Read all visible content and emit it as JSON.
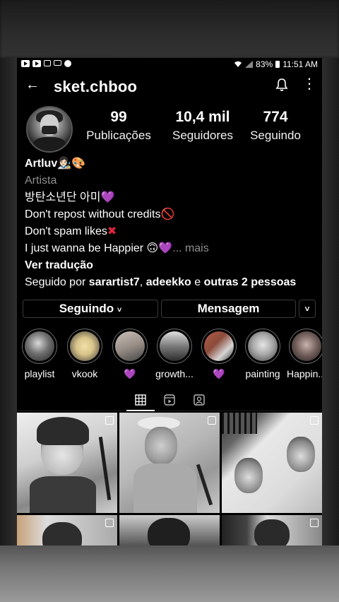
{
  "status_bar": {
    "battery": "83%",
    "time": "11:51 AM"
  },
  "header": {
    "username": "sket.chboo",
    "icons": [
      "back-arrow-icon",
      "bell-icon",
      "more-vertical-icon"
    ]
  },
  "stats": [
    {
      "value": "99",
      "label": "Publicações"
    },
    {
      "value": "10,4 mil",
      "label": "Seguidores"
    },
    {
      "value": "774",
      "label": "Seguindo"
    }
  ],
  "bio": {
    "name": "Artluv👩🏻‍🎨🎨",
    "category": "Artista",
    "lines": [
      "방탄소년단 아미",
      "Don't repost without credits",
      "Don't spam likes",
      "I just wanna be Happier 🙃"
    ],
    "more": "... mais",
    "translate": "Ver tradução",
    "followed_by_prefix": "Seguido por",
    "followed_by_1": "sarartist7",
    "followed_by_sep": ",",
    "followed_by_2": "adeekko",
    "followed_by_and": "e",
    "followed_by_others": "outras 2 pessoas"
  },
  "buttons": {
    "following": "Seguindo",
    "following_caret": "˅",
    "message": "Mensagem",
    "more_caret": "˅"
  },
  "highlights": [
    {
      "label": "playlist",
      "color": "#6e6e6e"
    },
    {
      "label": "vkook",
      "color": "#d9c48a"
    },
    {
      "label": "💜",
      "color": "#9a8f88"
    },
    {
      "label": "growth...",
      "color": "#7a7a7a"
    },
    {
      "label": "💜",
      "color": "#8b4a3a"
    },
    {
      "label": "painting",
      "color": "#a9a9a9"
    },
    {
      "label": "Happin...",
      "color": "#6f5b57"
    }
  ],
  "tabs": [
    "grid-icon",
    "reels-icon",
    "tagged-icon"
  ],
  "colors": {
    "background": "#000000",
    "muted_text": "#8e8e8e",
    "heart_purple": "#b44cf2",
    "red": "#e0243c",
    "button_border": "#3a3a3a"
  }
}
